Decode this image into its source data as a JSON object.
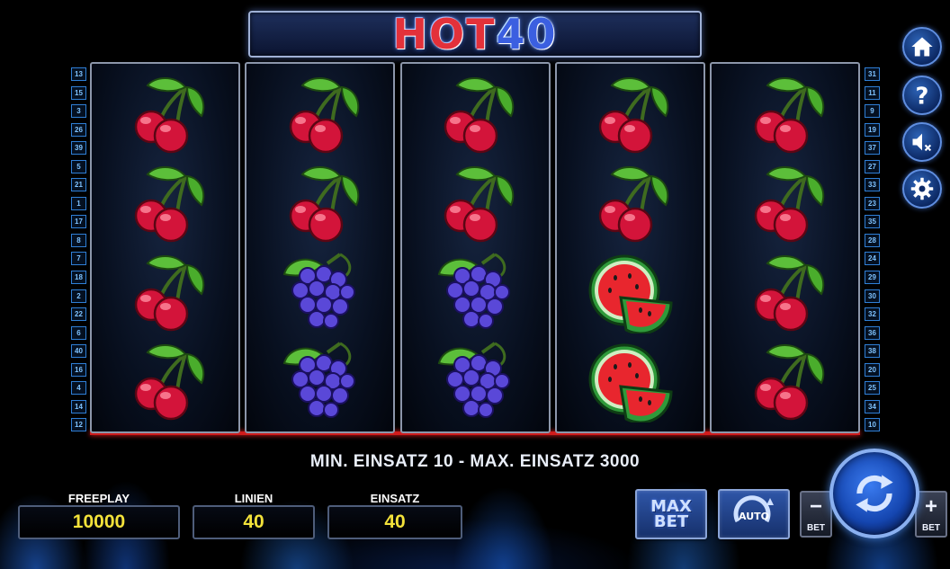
{
  "title": {
    "part1": "HOT",
    "part2": "40"
  },
  "reels": [
    [
      "cherry",
      "cherry",
      "cherry",
      "cherry"
    ],
    [
      "cherry",
      "cherry",
      "grapes",
      "grapes"
    ],
    [
      "cherry",
      "cherry",
      "grapes",
      "grapes"
    ],
    [
      "cherry",
      "cherry",
      "watermelon",
      "watermelon"
    ],
    [
      "cherry",
      "cherry",
      "cherry",
      "cherry"
    ]
  ],
  "left_lines": [
    "13",
    "15",
    "3",
    "26",
    "39",
    "5",
    "21",
    "1",
    "17",
    "8",
    "7",
    "18",
    "2",
    "22",
    "6",
    "40",
    "16",
    "4",
    "14",
    "12"
  ],
  "right_lines": [
    "31",
    "11",
    "9",
    "19",
    "37",
    "27",
    "33",
    "23",
    "35",
    "28",
    "24",
    "29",
    "30",
    "32",
    "36",
    "38",
    "20",
    "25",
    "34",
    "10"
  ],
  "side_buttons": [
    {
      "name": "home-button",
      "icon": "home-icon"
    },
    {
      "name": "help-button",
      "icon": "question-icon"
    },
    {
      "name": "sound-button",
      "icon": "sound-muted-icon"
    },
    {
      "name": "settings-button",
      "icon": "gear-icon"
    }
  ],
  "info": "MIN. EINSATZ 10 - MAX. EINSATZ 3000",
  "freeplay": {
    "label": "FREEPLAY",
    "value": "10000"
  },
  "linien": {
    "label": "LINIEN",
    "value": "40"
  },
  "einsatz": {
    "label": "EINSATZ",
    "value": "40"
  },
  "buttons": {
    "max_bet_line1": "MAX",
    "max_bet_line2": "BET",
    "auto": "AUTO",
    "bet_minus_sign": "−",
    "bet_minus_word": "BET",
    "bet_plus_sign": "+",
    "bet_plus_word": "BET"
  },
  "colors": {
    "value_text": "#f3e23a",
    "reel_border_bottom": "#d01c1c",
    "accent_blue": "#2f7fd6"
  }
}
